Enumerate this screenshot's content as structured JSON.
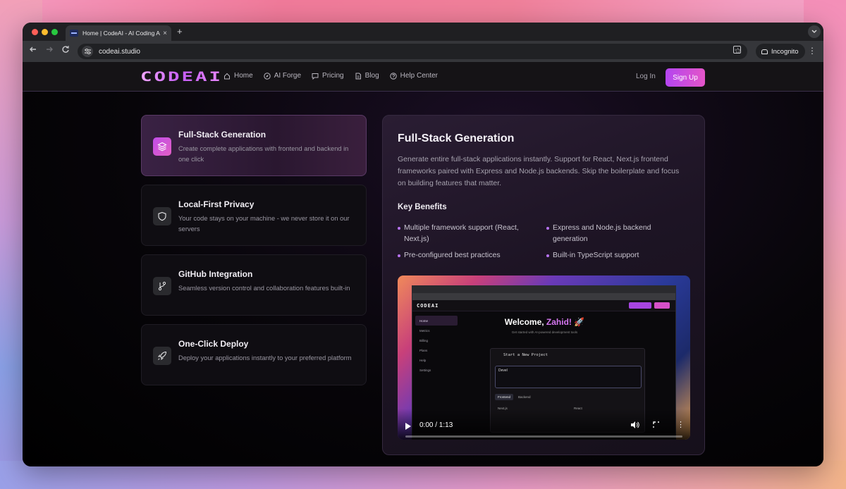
{
  "browser": {
    "tab_title": "Home | CodeAI - AI Coding A",
    "tab_close": "×",
    "new_tab": "+",
    "url": "codeai.studio",
    "incognito_label": "Incognito"
  },
  "nav": {
    "logo": "CODEAI",
    "links": [
      {
        "label": "Home",
        "icon": "home-icon"
      },
      {
        "label": "AI Forge",
        "icon": "compass-icon"
      },
      {
        "label": "Pricing",
        "icon": "chat-icon"
      },
      {
        "label": "Blog",
        "icon": "document-icon"
      },
      {
        "label": "Help Center",
        "icon": "help-icon"
      }
    ],
    "login": "Log In",
    "signup": "Sign Up"
  },
  "features": [
    {
      "title": "Full-Stack Generation",
      "desc": "Create complete applications with frontend and backend in one click",
      "icon": "layers-icon",
      "active": true
    },
    {
      "title": "Local-First Privacy",
      "desc": "Your code stays on your machine - we never store it on our servers",
      "icon": "shield-icon",
      "active": false
    },
    {
      "title": "GitHub Integration",
      "desc": "Seamless version control and collaboration features built-in",
      "icon": "git-branch-icon",
      "active": false
    },
    {
      "title": "One-Click Deploy",
      "desc": "Deploy your applications instantly to your preferred platform",
      "icon": "rocket-icon",
      "active": false
    }
  ],
  "detail": {
    "title": "Full-Stack Generation",
    "description": "Generate entire full-stack applications instantly. Support for React, Next.js frontend frameworks paired with Express and Node.js backends. Skip the boilerplate and focus on building features that matter.",
    "benefits_heading": "Key Benefits",
    "benefits": [
      "Multiple framework support (React, Next.js)",
      "Express and Node.js backend generation",
      "Pre-configured best practices",
      "Built-in TypeScript support"
    ]
  },
  "video": {
    "time": "0:00 / 1:13",
    "progress": 0,
    "screen": {
      "logo": "CODEAI",
      "welcome_prefix": "Welcome, ",
      "welcome_name": "Zahid!",
      "welcome_emoji": "🚀",
      "subtitle": "Get started with AI-powered development tools",
      "sidebar": [
        "Home",
        "Metrics",
        "Billing",
        "Plans",
        "Help",
        "Settings"
      ],
      "card_title": "Start a New Project",
      "input_text": "Devel",
      "tabs": [
        "Frontend",
        "Backend"
      ],
      "options": [
        "Next.js",
        "React"
      ]
    }
  }
}
